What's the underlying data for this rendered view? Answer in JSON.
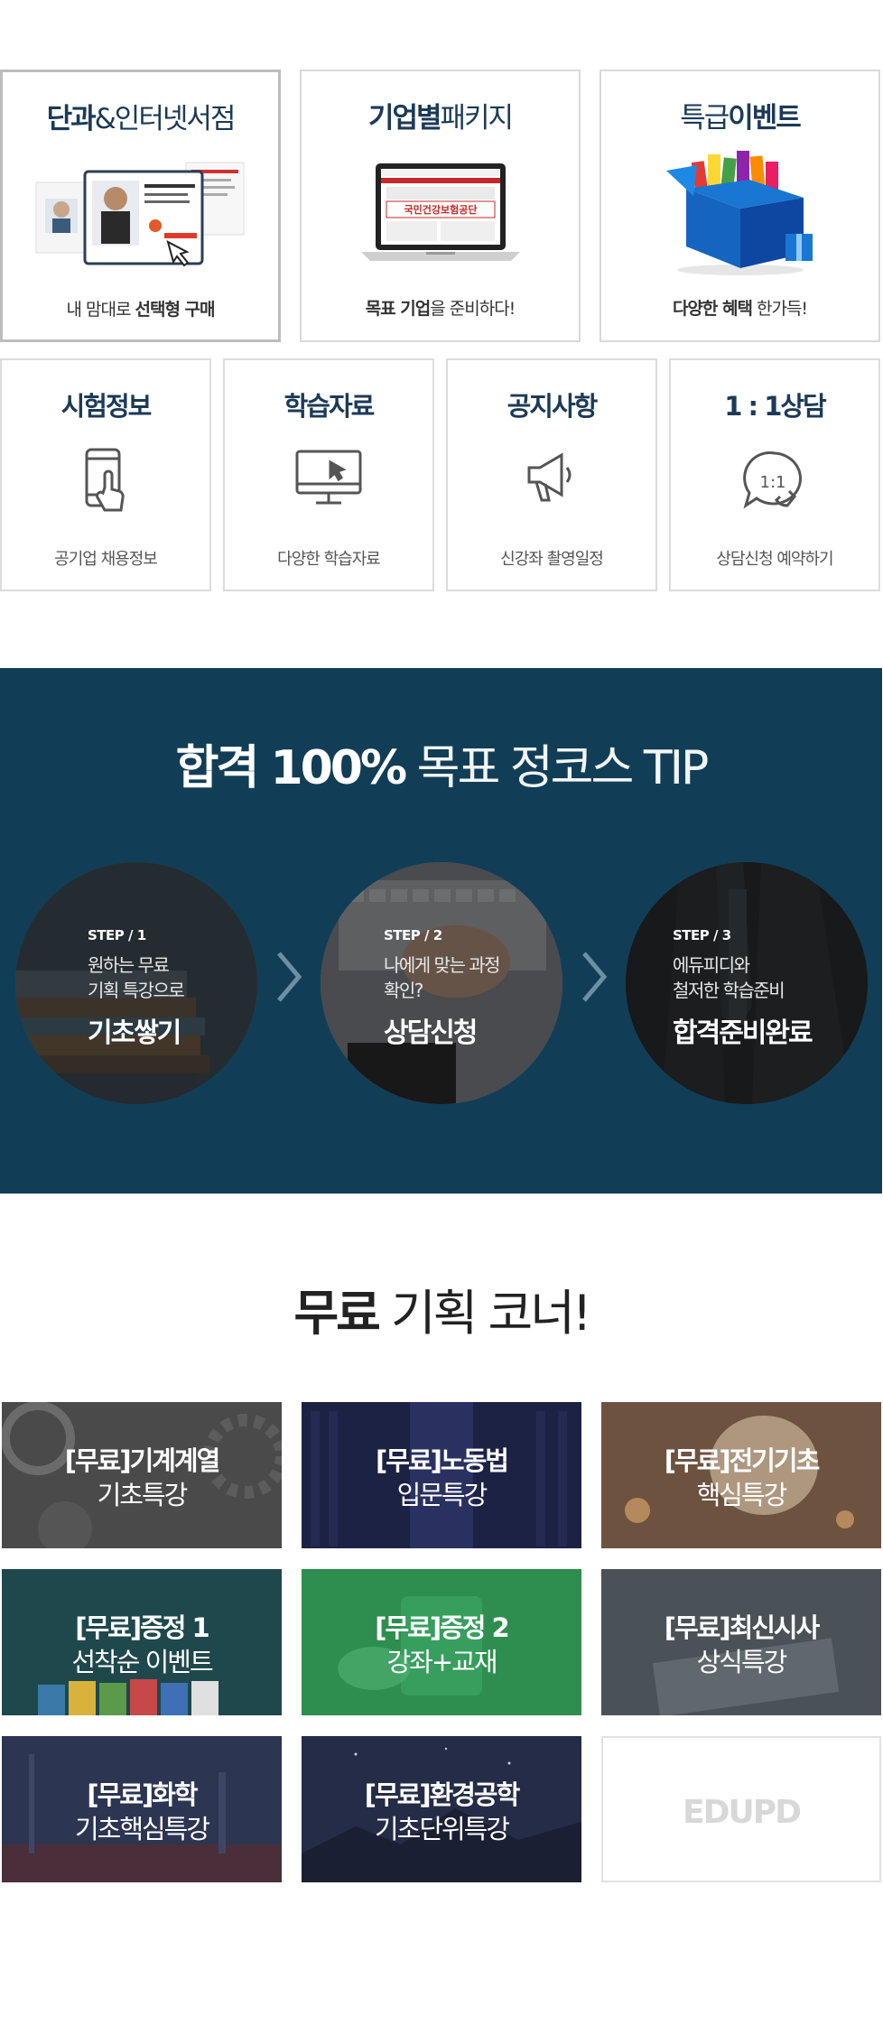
{
  "cards_top": [
    {
      "title_bold": "단과",
      "title_rest": "&인터넷서점",
      "sub_pre": "내 맘대로 ",
      "sub_bold": "선택형 구매",
      "sub_post": ""
    },
    {
      "title_bold": "기업별",
      "title_rest": "패키지",
      "sub_pre": "",
      "sub_bold": "목표 기업",
      "sub_post": "을 준비하다!"
    },
    {
      "title_bold": "이벤트",
      "title_pre": "특급",
      "sub_pre": "",
      "sub_bold": "다양한 혜택",
      "sub_post": " 한가득!"
    }
  ],
  "cards_small": [
    {
      "title": "시험정보",
      "sub": "공기업 채용정보",
      "icon": "smartphone-touch-icon"
    },
    {
      "title": "학습자료",
      "sub": "다양한 학습자료",
      "icon": "monitor-cursor-icon"
    },
    {
      "title": "공지사항",
      "sub": "신강좌 촬영일정",
      "icon": "megaphone-icon"
    },
    {
      "title": "1 : 1상담",
      "sub": "상담신청 예약하기",
      "icon": "phone-chat-icon",
      "icon_text": "1:1"
    }
  ],
  "tip": {
    "title_bold": "합격 100%",
    "title_rest": " 목표 정코스 TIP",
    "steps": [
      {
        "tag": "STEP / 1",
        "desc1": "원하는 무료",
        "desc2": "기획 특강으로",
        "big": "기초쌓기"
      },
      {
        "tag": "STEP / 2",
        "desc1": "나에게 맞는 과정",
        "desc2": "확인?",
        "big": "상담신청"
      },
      {
        "tag": "STEP / 3",
        "desc1": "에듀피디와",
        "desc2": "철저한 학습준비",
        "big": "합격준비완료"
      }
    ]
  },
  "free": {
    "title_bold": "무료",
    "title_rest": " 기획 코너!",
    "tiles": [
      {
        "line1": "[무료]기계계열",
        "line2": "기초특강"
      },
      {
        "line1": "[무료]노동법",
        "line2": "입문특강"
      },
      {
        "line1": "[무료]전기기초",
        "line2": "핵심특강"
      },
      {
        "line1": "[무료]증정 1",
        "line2": "선착순 이벤트"
      },
      {
        "line1": "[무료]증정 2",
        "line2": "강좌+교재"
      },
      {
        "line1": "[무료]최신시사",
        "line2": "상식특강"
      },
      {
        "line1": "[무료]화학",
        "line2": "기초핵심특강"
      },
      {
        "line1": "[무료]환경공학",
        "line2": "기초단위특강"
      }
    ],
    "placeholder_logo": "EDUPD"
  },
  "colors": {
    "navy": "#1b3a57",
    "band": "#113e56"
  }
}
